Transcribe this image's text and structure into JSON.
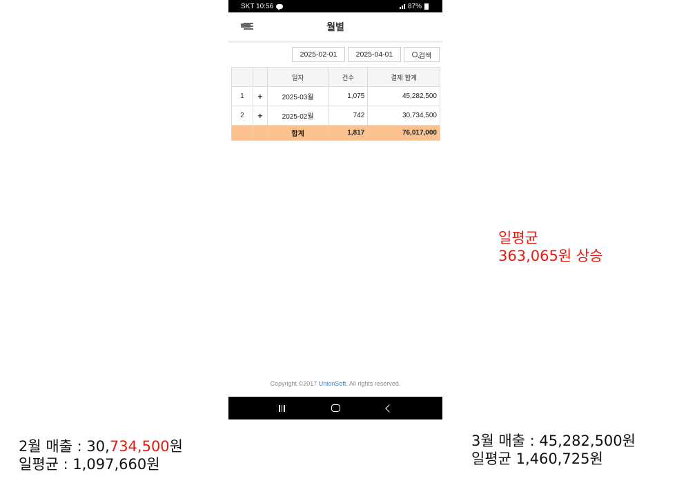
{
  "status_bar": {
    "carrier_time": "SKT 10:56",
    "battery": "87%"
  },
  "app_bar": {
    "title": "월별"
  },
  "filters": {
    "start_date": "2025-02-01",
    "end_date": "2025-04-01",
    "search_label": "검색"
  },
  "table": {
    "headers": [
      "",
      "",
      "일자",
      "건수",
      "결제 합계"
    ],
    "rows": [
      {
        "no": "1",
        "expand": "+",
        "date": "2025-03월",
        "count": "1,075",
        "total": "45,282,500"
      },
      {
        "no": "2",
        "expand": "+",
        "date": "2025-02월",
        "count": "742",
        "total": "30,734,500"
      }
    ],
    "footer": {
      "label": "합계",
      "count": "1,817",
      "total": "76,017,000"
    }
  },
  "footer": {
    "copyright_prefix": "Copyright ©2017 ",
    "brand": "UnionSoft",
    "copyright_suffix": ". All rights reserved."
  },
  "annotations": {
    "middle": {
      "line1": "일평균",
      "line2": "363,065원 상승"
    },
    "left": {
      "line1_prefix": "2월 매출 : 30,",
      "line1_highlight": "734,500",
      "line1_suffix": "원",
      "line2": "일평균 : 1,097,660원"
    },
    "right": {
      "line1": "3월 매출 : 45,282,500원",
      "line2": "일평균 1,460,725원"
    }
  },
  "colors": {
    "total_row": "#fbc290",
    "annotation_red": "#e8190f",
    "brand_link": "#3a7fbf"
  }
}
